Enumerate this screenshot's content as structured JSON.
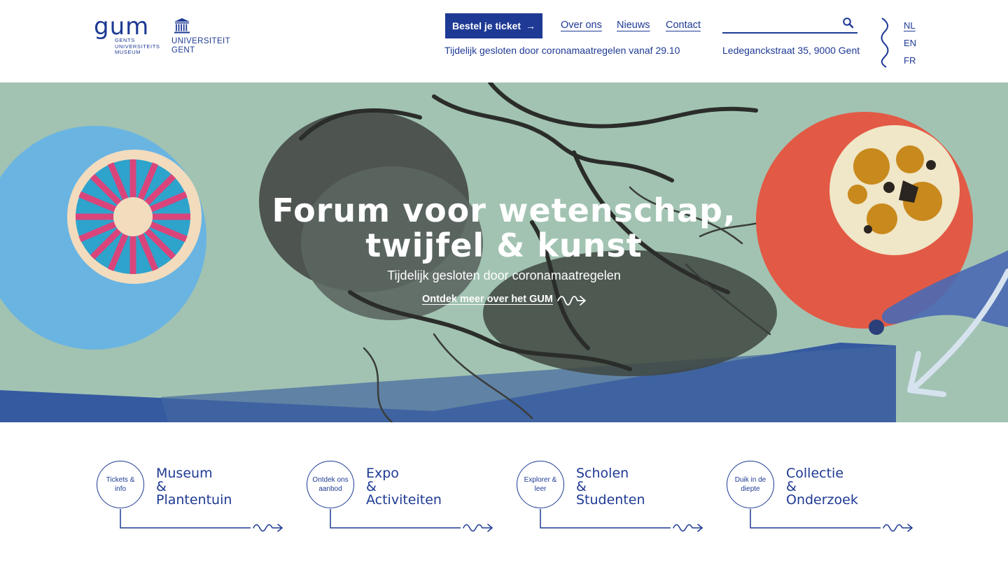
{
  "header": {
    "logo_gum": {
      "word": "gum",
      "sub": [
        "GENTS",
        "UNIVERSITEITS",
        "MUSEUM"
      ]
    },
    "logo_ugent": [
      "UNIVERSITEIT",
      "GENT"
    ],
    "ticket_button": "Bestel je ticket",
    "nav": [
      "Over ons",
      "Nieuws",
      "Contact"
    ],
    "notice": "Tijdelijk gesloten door coronamaatregelen vanaf 29.10",
    "address": "Ledeganckstraat 35, 9000 Gent",
    "search": {
      "value": "",
      "placeholder": ""
    },
    "languages": [
      "NL",
      "EN",
      "FR"
    ],
    "active_language": "NL"
  },
  "hero": {
    "title_line1": "Forum voor wetenschap,",
    "title_line2": "twijfel & kunst",
    "subtitle": "Tijdelijk gesloten door coronamaatregelen",
    "link": "Ontdek meer over het GUM"
  },
  "tiles": [
    {
      "circle": "Tickets & info",
      "title": [
        "Museum",
        "&",
        "Plantentuin"
      ]
    },
    {
      "circle": "Ontdek ons aanbod",
      "title": [
        "Expo",
        "&",
        "Activiteiten"
      ]
    },
    {
      "circle": "Explorer & leer",
      "title": [
        "Scholen",
        "&",
        "Studenten"
      ]
    },
    {
      "circle": "Duik in de diepte",
      "title": [
        "Collectie",
        "&",
        "Onderzoek"
      ]
    }
  ],
  "colors": {
    "brand_blue": "#1e3a94",
    "hero_green": "#a2c3b2",
    "circle_blue": "#6ab4e2",
    "circle_red": "#e25a45",
    "white": "#ffffff"
  },
  "icons": [
    "search-icon",
    "arrow-right-icon",
    "squiggle-arrow-icon",
    "university-building-icon"
  ]
}
